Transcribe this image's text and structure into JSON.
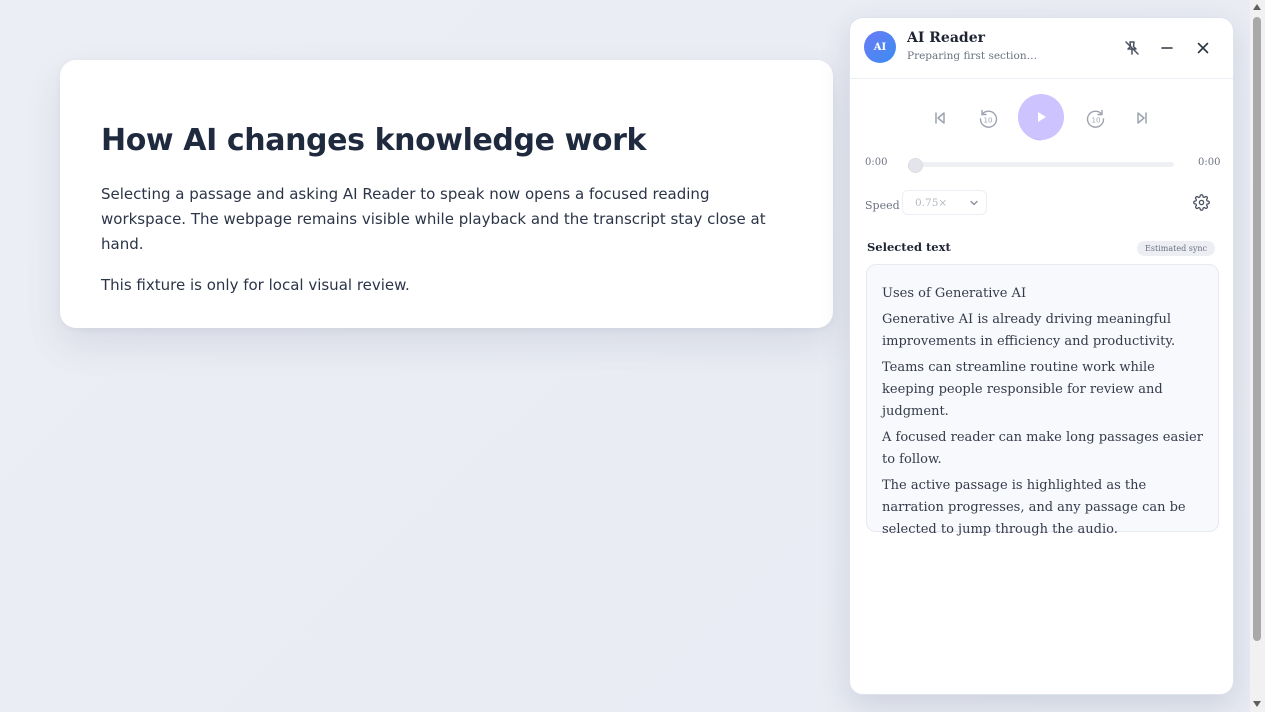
{
  "article": {
    "title": "How AI changes knowledge work",
    "paragraphs": [
      "Selecting a passage and asking AI Reader to speak now opens a focused reading workspace. The webpage remains visible while playback and the transcript stay close at hand.",
      "This fixture is only for local visual review."
    ]
  },
  "reader": {
    "avatar_text": "AI",
    "title": "AI Reader",
    "subtitle": "Preparing first section…",
    "header_icons": [
      "unpin-icon",
      "minimize-icon",
      "close-icon"
    ],
    "controls": [
      "skip-back-icon",
      "rewind-10-icon",
      "play-icon",
      "forward-10-icon",
      "skip-forward-icon"
    ],
    "progress": {
      "current_time": "0:00",
      "total_time": "0:00",
      "fraction": 0.0
    },
    "speed": {
      "label": "Speed",
      "value": "0.75×"
    },
    "selected_text": {
      "heading": "Selected text",
      "badge": "Estimated sync",
      "passages": [
        "Uses of Generative AI",
        "Generative AI is already driving meaningful improvements in efficiency and productivity.",
        "Teams can streamline routine work while keeping people responsible for review and judgment.",
        "A focused reader can make long passages easier to follow.",
        "The active passage is highlighted as the narration progresses, and any passage can be selected to jump through the audio."
      ]
    }
  },
  "colors": {
    "accent": "#7c6cf2",
    "play_fill": "#cdc3ff",
    "avatar_start": "#6b7bf7",
    "avatar_end": "#3a8cf0"
  }
}
